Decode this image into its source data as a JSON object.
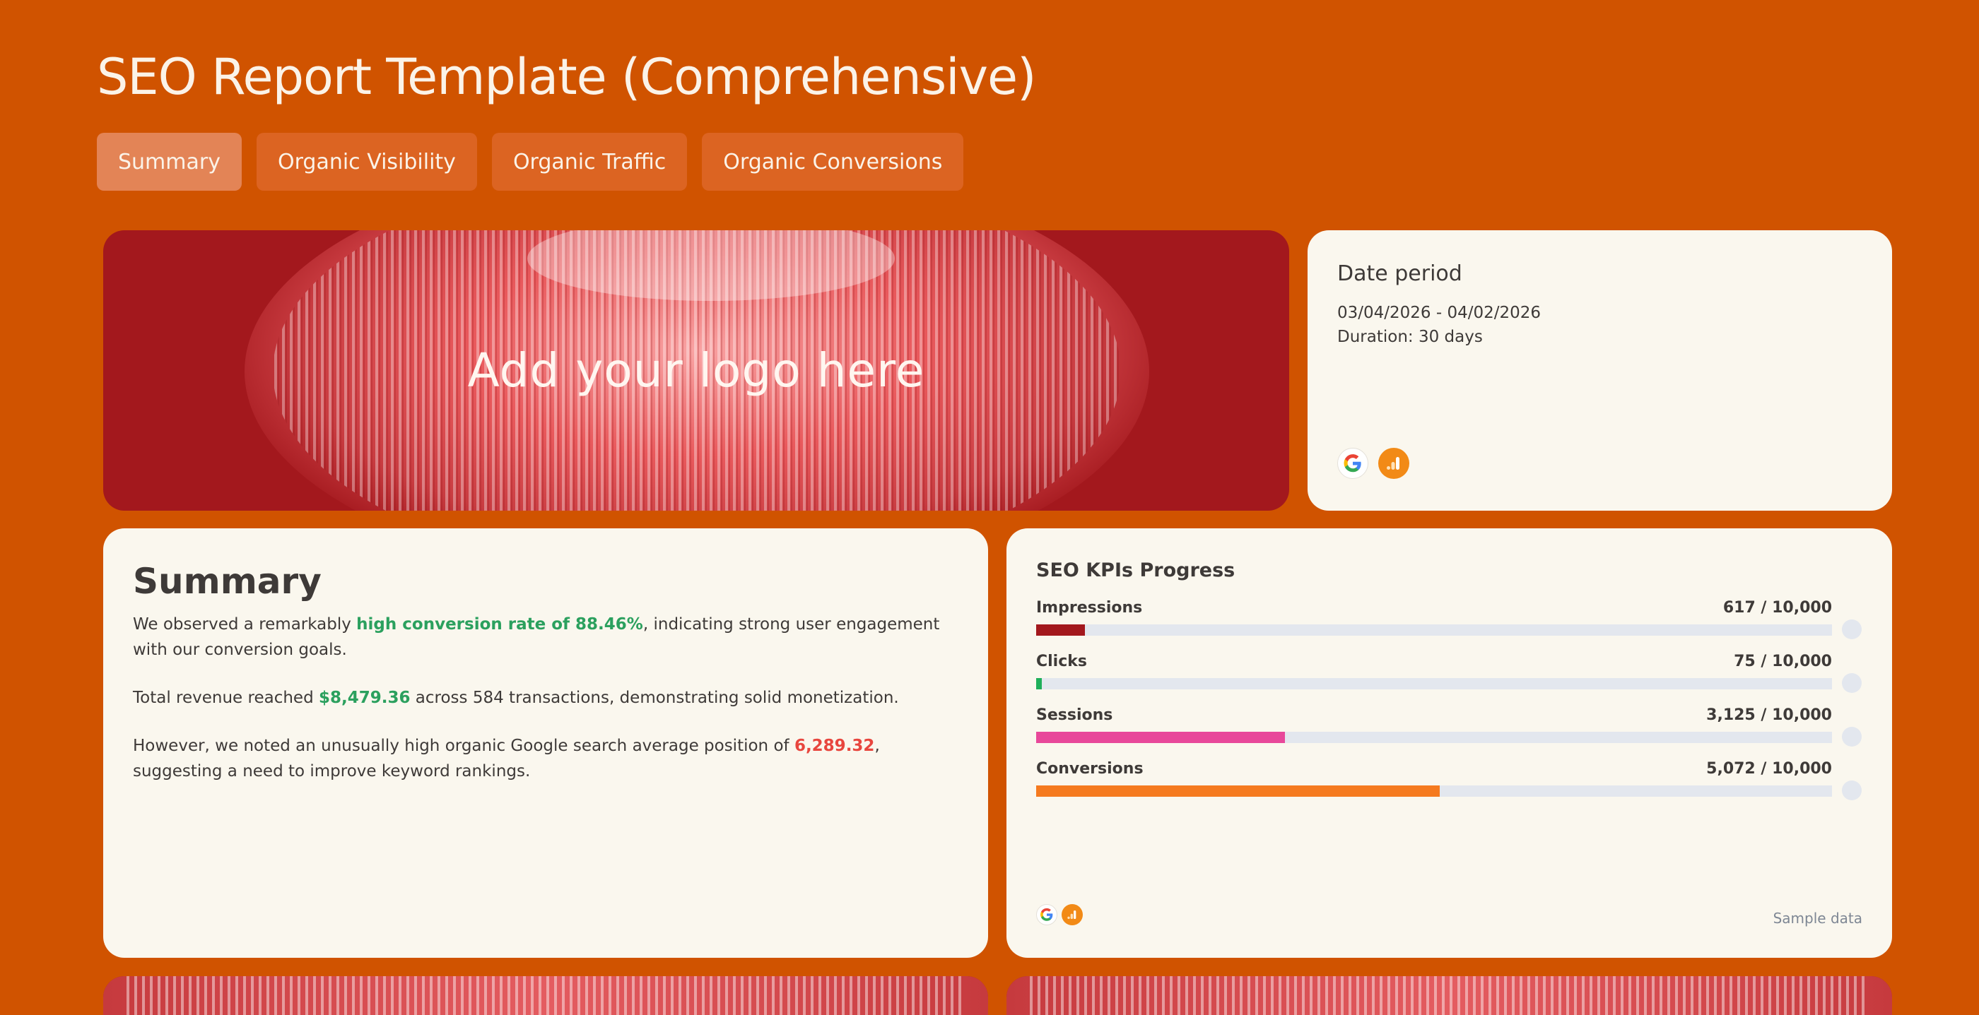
{
  "page": {
    "title": "SEO Report Template (Comprehensive)"
  },
  "tabs": [
    {
      "label": "Summary",
      "active": true
    },
    {
      "label": "Organic Visibility",
      "active": false
    },
    {
      "label": "Organic Traffic",
      "active": false
    },
    {
      "label": "Organic Conversions",
      "active": false
    }
  ],
  "hero": {
    "logo_placeholder": "Add your logo here"
  },
  "date_card": {
    "title": "Date period",
    "range": "03/04/2026 - 04/02/2026",
    "duration": "Duration:  30 days",
    "sources": [
      "google-icon",
      "analytics-icon"
    ]
  },
  "summary": {
    "title": "Summary",
    "p1_pre": "We observed a remarkably ",
    "p1_highlight": "high conversion rate of 88.46%",
    "p1_post": ", indicating strong user engagement with our conversion goals.",
    "p2_pre": "Total revenue reached ",
    "p2_highlight": "$8,479.36",
    "p2_post": " across 584 transactions, demonstrating solid monetization.",
    "p3_pre": "However, we noted an unusually high organic Google search average position of ",
    "p3_highlight": "6,289.32",
    "p3_post": ", suggesting a need to improve keyword rankings."
  },
  "kpis": {
    "title": "SEO KPIs Progress",
    "sample_note": "Sample data",
    "items": [
      {
        "label": "Impressions",
        "value_text": "617 / 10,000",
        "progress": 0.0617,
        "color": "#A3181D"
      },
      {
        "label": "Clicks",
        "value_text": "75 / 10,000",
        "progress": 0.0075,
        "color": "#1FAF5A"
      },
      {
        "label": "Sessions",
        "value_text": "3,125 / 10,000",
        "progress": 0.3125,
        "color": "#E8489A"
      },
      {
        "label": "Conversions",
        "value_text": "5,072 / 10,000",
        "progress": 0.5072,
        "color": "#F57A1F"
      }
    ],
    "sources": [
      "google-icon",
      "analytics-icon"
    ]
  },
  "colors": {
    "background": "#D05300",
    "card": "#FAF7EE",
    "hero": "#A3181D",
    "tab": "#DC6422",
    "tab_active": "#E38456"
  }
}
